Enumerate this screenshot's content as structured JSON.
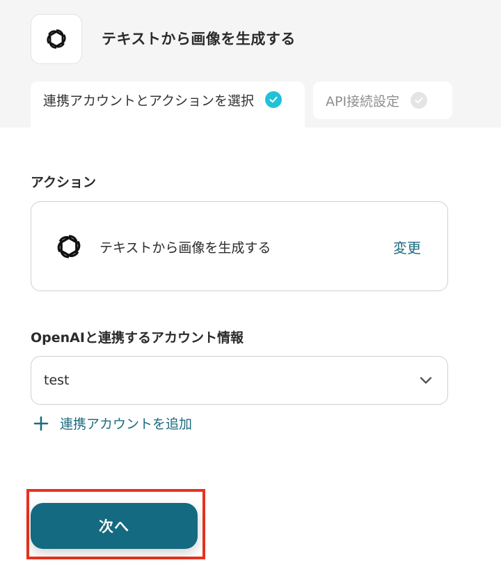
{
  "header": {
    "app_icon": "openai-logo-icon",
    "title": "テキストから画像を生成する"
  },
  "tabs": [
    {
      "label": "連携アカウントとアクションを選択",
      "state": "active",
      "icon": "check-icon"
    },
    {
      "label": "API接続設定",
      "state": "inactive",
      "icon": "check-icon"
    }
  ],
  "action_section": {
    "label": "アクション",
    "action_icon": "openai-logo-icon",
    "action_name": "テキストから画像を生成する",
    "change_label": "変更"
  },
  "account_section": {
    "label": "OpenAIと連携するアカウント情報",
    "selected_account": "test",
    "dropdown_icon": "chevron-down-icon",
    "add_account_label": "連携アカウントを追加",
    "add_icon": "plus-icon"
  },
  "footer": {
    "next_label": "次へ"
  },
  "colors": {
    "accent": "#146a80",
    "link": "#1d6b80",
    "check_active": "#21c1d8",
    "highlight": "#e8321d"
  }
}
